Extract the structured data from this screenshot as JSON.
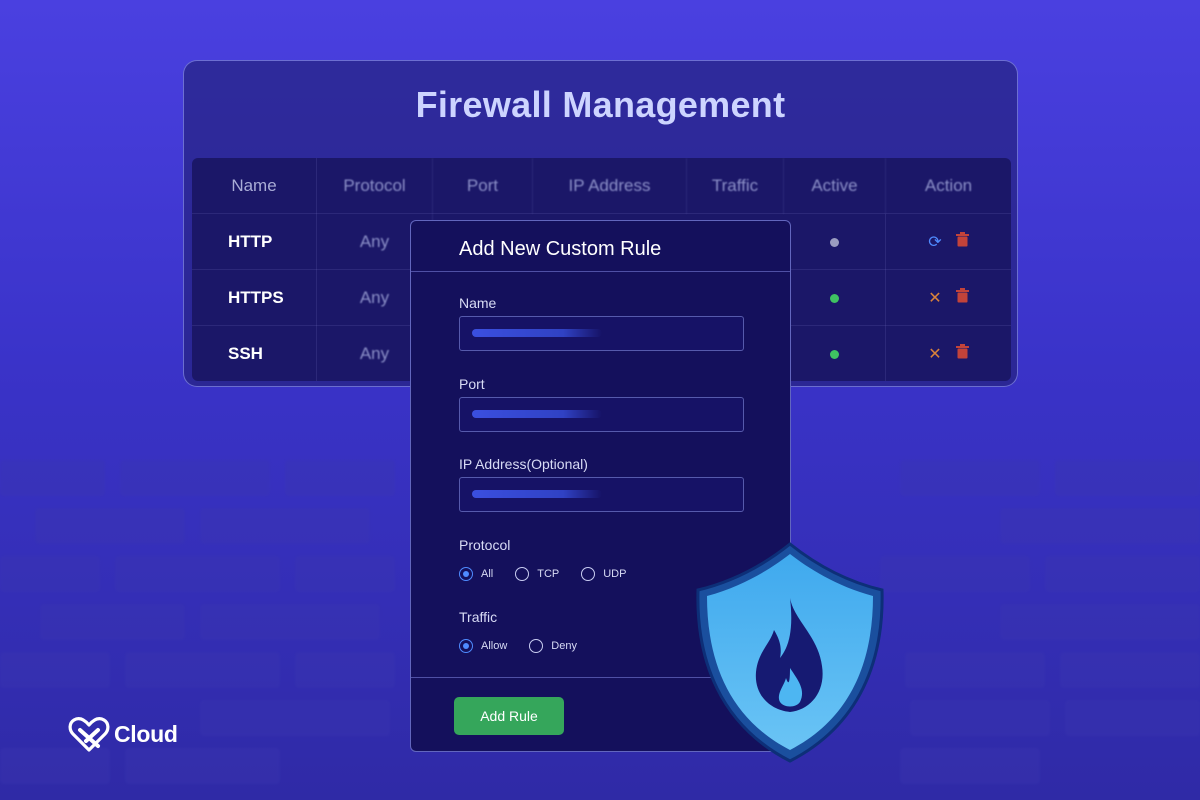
{
  "panel": {
    "title": "Firewall Management"
  },
  "table": {
    "headers": [
      "Name",
      "Protocol",
      "Port",
      "IP Address",
      "Traffic",
      "Active",
      "Action"
    ],
    "rows": [
      {
        "name": "HTTP",
        "protocol": "Any",
        "active_color": "#9a9cc0",
        "action_icons": [
          "refresh-icon",
          "trash-icon"
        ]
      },
      {
        "name": "HTTPS",
        "protocol": "Any",
        "active_color": "#3fc262",
        "action_icons": [
          "close-icon",
          "trash-icon"
        ]
      },
      {
        "name": "SSH",
        "protocol": "Any",
        "active_color": "#3fc262",
        "action_icons": [
          "close-icon",
          "trash-icon"
        ]
      }
    ]
  },
  "modal": {
    "title": "Add New Custom Rule",
    "fields": {
      "name_label": "Name",
      "port_label": "Port",
      "ip_label": "IP Address(Optional)"
    },
    "protocol": {
      "label": "Protocol",
      "options": [
        "All",
        "TCP",
        "UDP"
      ],
      "selected": "All"
    },
    "traffic": {
      "label": "Traffic",
      "options": [
        "Allow",
        "Deny"
      ],
      "selected": "Allow"
    },
    "submit_label": "Add Rule"
  },
  "brand": {
    "name": "Cloud"
  },
  "colors": {
    "accent_blue": "#4f8bff",
    "active_green": "#3fc262",
    "button_green": "#35a65b",
    "trash_red": "#c2433a",
    "close_orange": "#d9823b",
    "shield_blue": "#4ab3f0"
  }
}
